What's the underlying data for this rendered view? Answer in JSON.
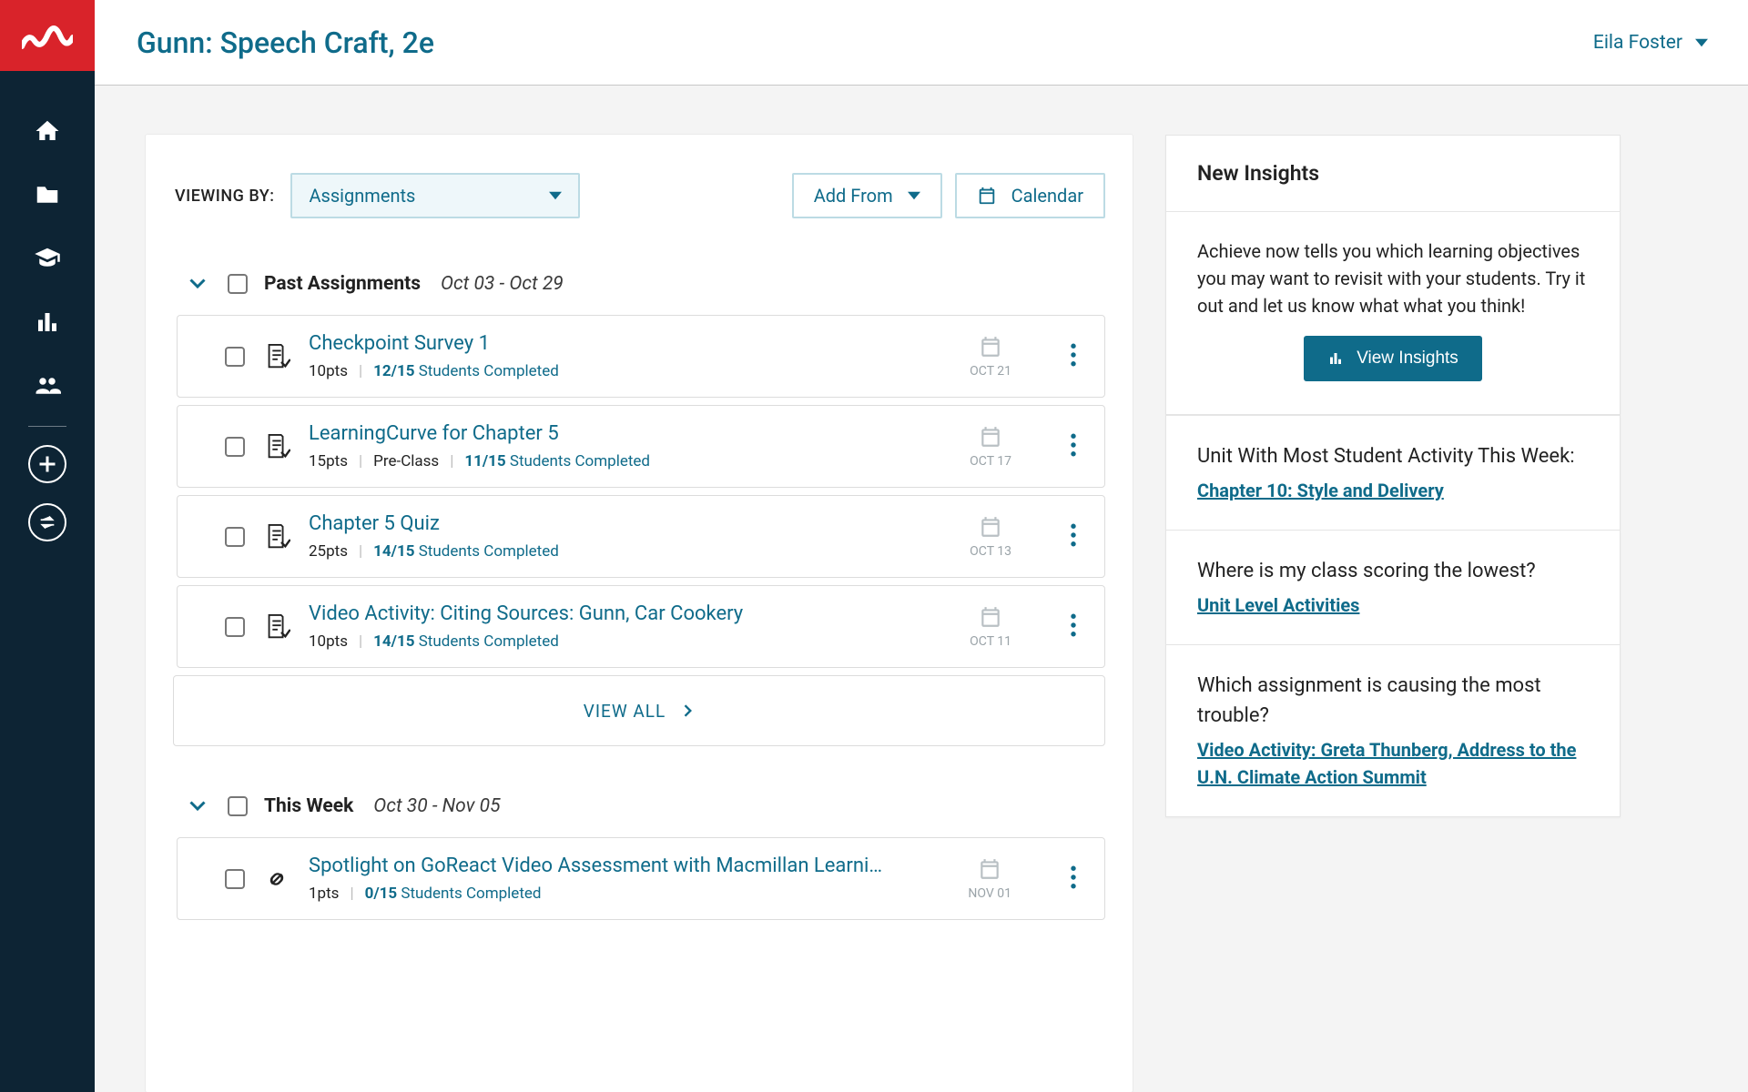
{
  "header": {
    "course_title": "Gunn: Speech Craft, 2e",
    "user_name": "Eila Foster"
  },
  "rail": {
    "items": [
      "home",
      "folder",
      "grad",
      "bars",
      "group"
    ]
  },
  "toolbar": {
    "viewing_label": "VIEWING BY:",
    "viewing_value": "Assignments",
    "add_from_label": "Add From",
    "calendar_label": "Calendar"
  },
  "sections": {
    "past": {
      "title": "Past Assignments",
      "range": "Oct 03 - Oct 29"
    },
    "thisweek": {
      "title": "This Week",
      "range": "Oct 30 - Nov 05"
    }
  },
  "past_assignments": [
    {
      "name": "Checkpoint Survey 1",
      "pts": "10pts",
      "preclass": "",
      "completed_frac": "12/15",
      "completed_txt": "Students Completed",
      "date": "OCT 21",
      "icon": "doc"
    },
    {
      "name": "LearningCurve for Chapter 5",
      "pts": "15pts",
      "preclass": "Pre-Class",
      "completed_frac": "11/15",
      "completed_txt": "Students Completed",
      "date": "OCT 17",
      "icon": "doc"
    },
    {
      "name": "Chapter 5 Quiz",
      "pts": "25pts",
      "preclass": "",
      "completed_frac": "14/15",
      "completed_txt": "Students Completed",
      "date": "OCT 13",
      "icon": "doc"
    },
    {
      "name": "Video Activity: Citing Sources: Gunn, Car Cookery",
      "pts": "10pts",
      "preclass": "",
      "completed_frac": "14/15",
      "completed_txt": "Students Completed",
      "date": "OCT 11",
      "icon": "doc"
    }
  ],
  "view_all_label": "VIEW ALL",
  "thisweek_assignments": [
    {
      "name": "Spotlight on GoReact Video Assessment with Macmillan Learni…",
      "pts": "1pts",
      "preclass": "",
      "completed_frac": "0/15",
      "completed_txt": "Students Completed",
      "date": "NOV 01",
      "icon": "link"
    }
  ],
  "insights": {
    "title": "New Insights",
    "desc": "Achieve now tells you which learning objectives you may want to revisit with your students. Try it out and let us know what what you think!",
    "button": "View Insights",
    "blocks": [
      {
        "heading": "Unit With Most Student Activity This Week:",
        "link": "Chapter 10: Style and Delivery"
      },
      {
        "heading": "Where is my class scoring the lowest?",
        "link": "Unit Level Activities"
      },
      {
        "heading": "Which assignment is causing the most trouble?",
        "link": "Video Activity: Greta Thunberg, Address to the U.N. Climate Action Summit"
      }
    ]
  }
}
